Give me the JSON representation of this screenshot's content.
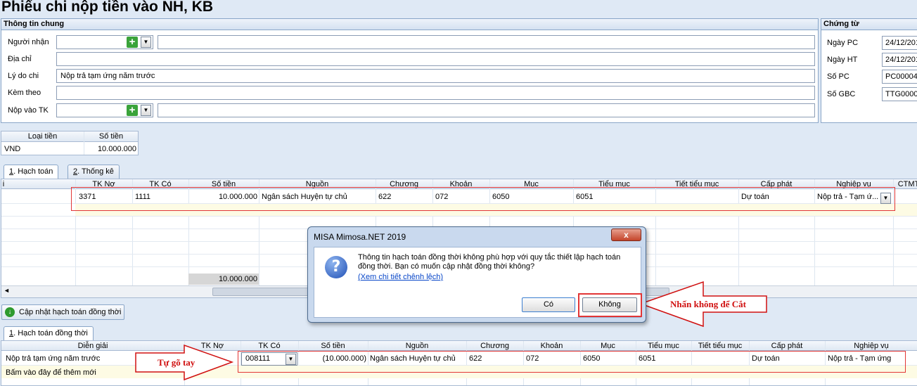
{
  "title": "Phiếu chi nộp tiền vào NH, KB",
  "general": {
    "header": "Thông tin chung",
    "receiver_label": "Người nhận",
    "address_label": "Địa chỉ",
    "reason_label": "Lý do chi",
    "reason_value": "Nộp trả tạm ứng năm trước",
    "attach_label": "Kèm theo",
    "account_label": "Nộp vào TK"
  },
  "voucher": {
    "header": "Chứng từ",
    "fields": [
      {
        "label": "Ngày PC",
        "value": "24/12/201"
      },
      {
        "label": "Ngày HT",
        "value": "24/12/201"
      },
      {
        "label": "Số PC",
        "value": "PC00004"
      },
      {
        "label": "Số GBC",
        "value": "TTG0000"
      }
    ]
  },
  "currency_grid": {
    "col_type": "Loại tiền",
    "col_amount": "Số tiền",
    "type": "VND",
    "amount": "10.000.000"
  },
  "tabs": [
    {
      "num": "1",
      "label": ". Hạch toán"
    },
    {
      "num": "2",
      "label": ". Thống kê"
    }
  ],
  "accounting_grid": {
    "headers": [
      "TK Nợ",
      "TK Có",
      "Số tiền",
      "Nguồn",
      "Chương",
      "Khoản",
      "Mục",
      "Tiểu mục",
      "Tiết tiểu mục",
      "Cấp phát",
      "Nghiệp vụ",
      "CTMT"
    ],
    "row": [
      "3371",
      "1111",
      "10.000.000",
      "Ngân sách Huyện tự chủ",
      "622",
      "072",
      "6050",
      "6051",
      "",
      "Dự toán",
      "Nộp trả - Tạm ứ..."
    ],
    "total": "10.000.000",
    "first_col_header": "i"
  },
  "update_button": "Cập nhật hạch toán đồng thời",
  "tab_simultaneous": {
    "num": "1",
    "label": ". Hạch toán đồng thời"
  },
  "simultaneous_grid": {
    "headers": [
      "Diễn giải",
      "TK Nợ",
      "TK Có",
      "Số tiền",
      "Nguồn",
      "Chương",
      "Khoản",
      "Mục",
      "Tiểu mục",
      "Tiết tiểu mục",
      "Cấp phát",
      "Nghiệp vụ"
    ],
    "row": [
      "Nộp trả tạm ứng năm trước",
      "",
      "008111",
      "(10.000.000)",
      "Ngân sách Huyện tự chủ",
      "622",
      "072",
      "6050",
      "6051",
      "",
      "Dự toán",
      "Nộp trả - Tạm ứng"
    ],
    "new_row_hint": "Bấm vào đây để thêm mới"
  },
  "dialog": {
    "title": "MISA Mimosa.NET 2019",
    "close": "x",
    "message": "Thông tin hạch toán đồng thời không phù hợp với quy tắc thiết lập hạch toán đồng thời. Bạn có muốn cập nhật đồng thời không?",
    "link": "(Xem chi tiết chênh lệch)",
    "yes": "Có",
    "no": "Không"
  },
  "annotations": {
    "press_no": "Nhấn không để Cắt",
    "manual": "Tự gõ tay"
  }
}
